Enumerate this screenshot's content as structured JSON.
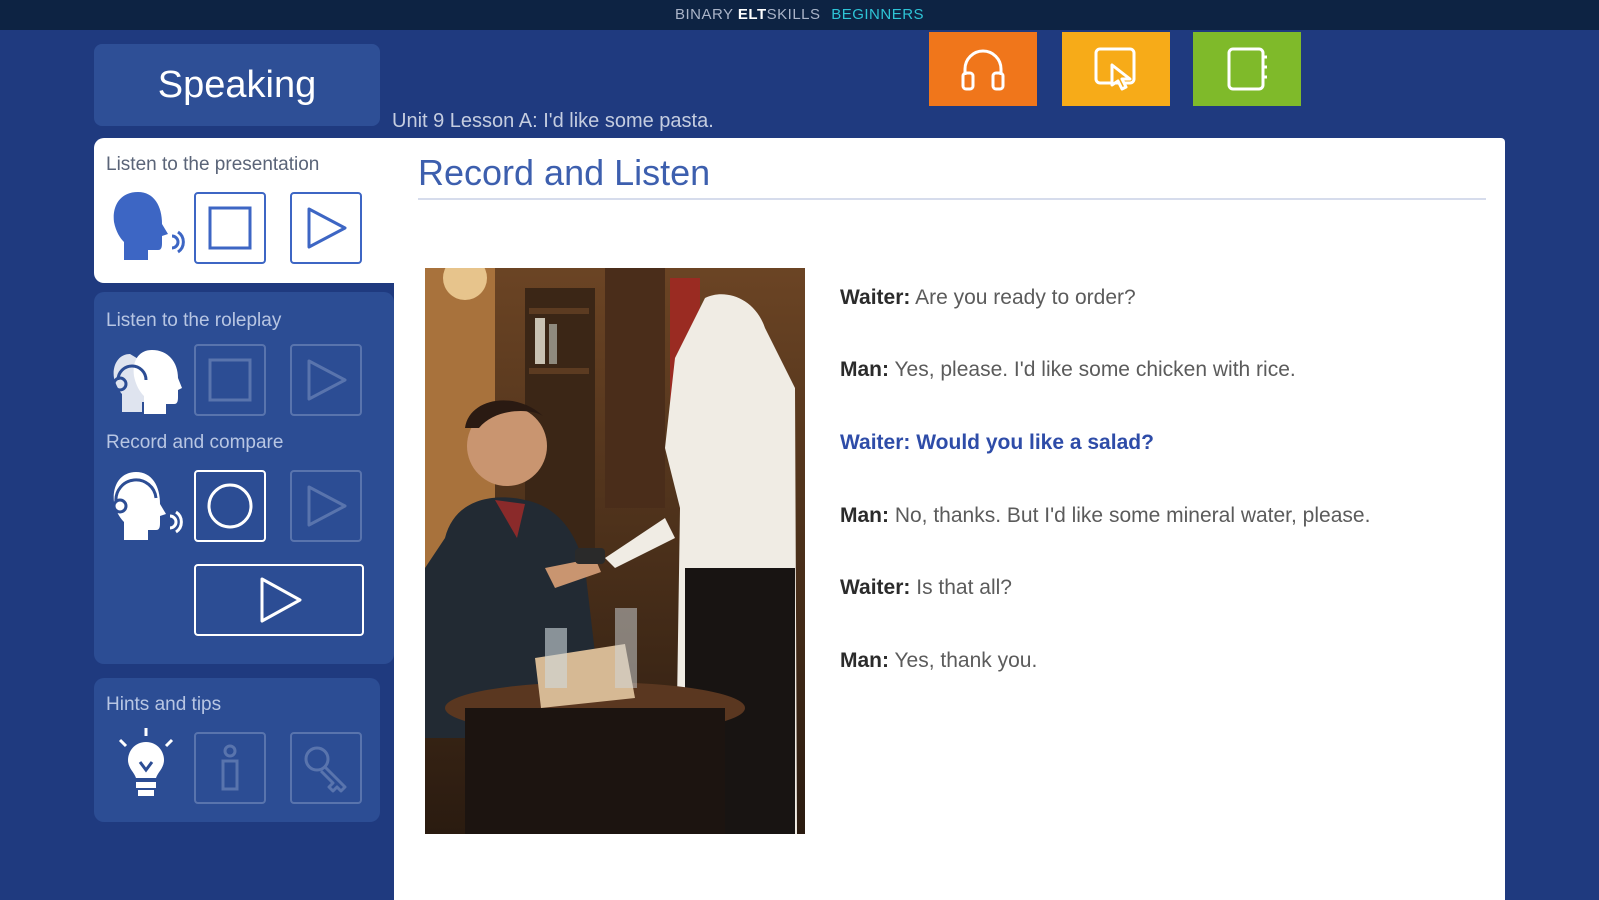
{
  "header": {
    "brand_binary": "BINARY",
    "brand_elt": "ELT",
    "brand_skills": "SKILLS",
    "brand_level": "BEGINNERS"
  },
  "section": {
    "title": "Speaking"
  },
  "lesson": {
    "title": "Unit 9 Lesson A: I'd like some pasta."
  },
  "tools": [
    {
      "icon": "headphones-icon",
      "color": "#f0761b"
    },
    {
      "icon": "touch-icon",
      "color": "#f7ab18"
    },
    {
      "icon": "notebook-icon",
      "color": "#7fba2a"
    }
  ],
  "sidebar": {
    "presentation": {
      "heading": "Listen to the presentation"
    },
    "roleplay": {
      "heading": "Listen to the roleplay"
    },
    "record": {
      "heading": "Record and compare"
    },
    "hints": {
      "heading": "Hints and tips"
    }
  },
  "content": {
    "title": "Record and Listen",
    "dialog": [
      {
        "speaker": "Waiter:",
        "text": " Are you ready to order?"
      },
      {
        "speaker": "Man:",
        "text": " Yes, please. I'd like some chicken with rice."
      },
      {
        "speaker": "Waiter:",
        "text": " Would you like a salad?"
      },
      {
        "speaker": "Man:",
        "text": " No, thanks. But I'd like some mineral water, please."
      },
      {
        "speaker": "Waiter:",
        "text": " Is that all?"
      },
      {
        "speaker": "Man:",
        "text": " Yes, thank you."
      }
    ]
  },
  "colors": {
    "background": "#1f3a7f",
    "highlight_text": "#2e4ca8",
    "listen_tool": "#f0761b",
    "touch_tool": "#f7ab18",
    "book_tool": "#7fba2a"
  }
}
